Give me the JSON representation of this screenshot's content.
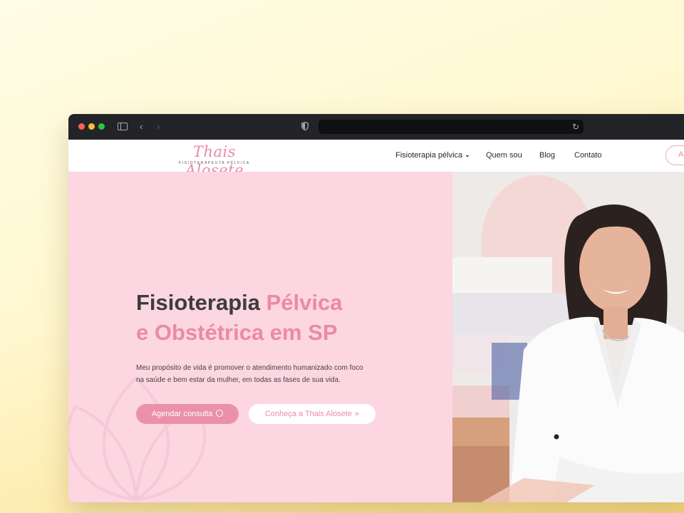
{
  "browser": {
    "address": ""
  },
  "header": {
    "logo_name": "Thais Alosete",
    "logo_tagline": "FISIOTERAPEUTA PÉLVICA",
    "nav": [
      {
        "label": "Fisioterapia pélvica",
        "has_dropdown": true
      },
      {
        "label": "Quem sou"
      },
      {
        "label": "Blog"
      },
      {
        "label": "Contato"
      }
    ],
    "cta_label": "A"
  },
  "hero": {
    "title_part1": "Fisioterapia",
    "title_part2": "Pélvica",
    "title_line2": "e Obstétrica em SP",
    "description": "Meu propósito de vida é promover o atendimento humanizado com foco na saúde e bem estar da mulher, em todas as fases de sua vida.",
    "primary_button": "Agendar consulta",
    "secondary_button": "Conheça a Thais Alosete"
  },
  "icons": {
    "back": "chevron-left-icon",
    "forward": "chevron-right-icon",
    "sidebar": "sidebar-icon",
    "shield": "shield-icon",
    "reload": "reload-icon",
    "whatsapp": "whatsapp-icon",
    "double_arrow": "double-chevron-right-icon",
    "dropdown": "chevron-down-icon"
  },
  "colors": {
    "accent_pink": "#ea8aa7",
    "hero_background": "#fcd6e1",
    "button_pink": "#eb90ac",
    "titlebar": "#232427"
  }
}
